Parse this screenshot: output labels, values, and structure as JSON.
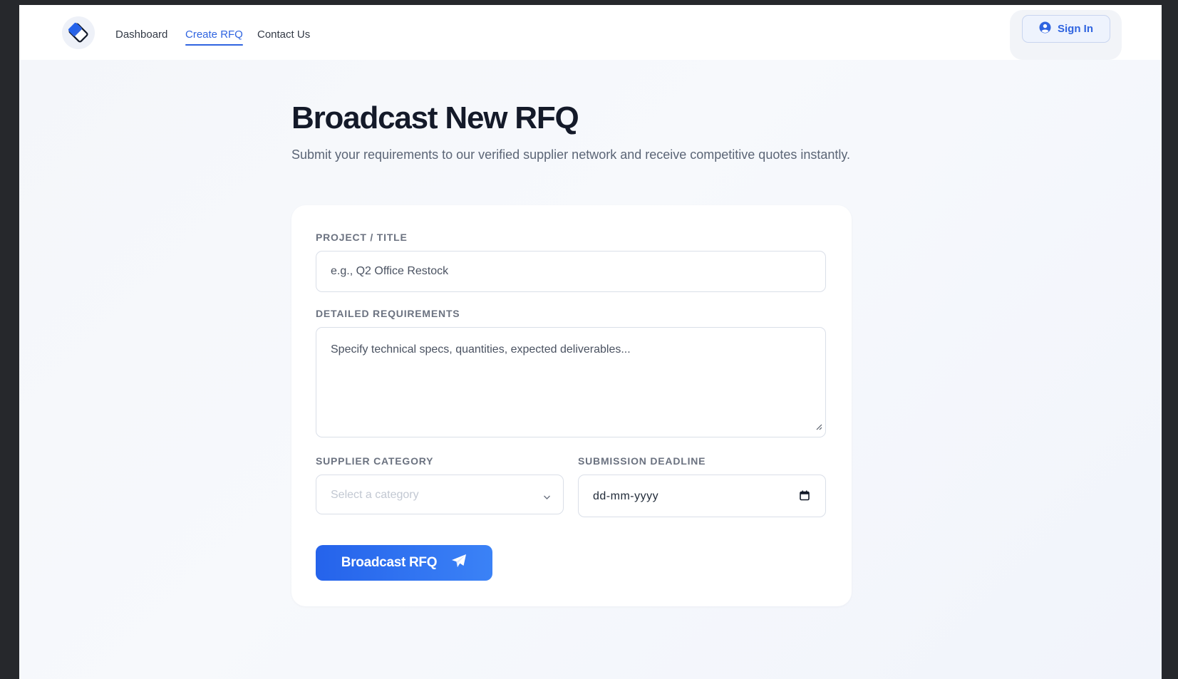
{
  "nav": {
    "logo_icon": "diamond-logo-icon",
    "links": [
      {
        "label": "Dashboard",
        "active": false
      },
      {
        "label": "Create RFQ",
        "active": true
      },
      {
        "label": "Contact Us",
        "active": false
      }
    ],
    "signin_label": "Sign In",
    "signin_icon": "user-circle-icon"
  },
  "page": {
    "title": "Broadcast New RFQ",
    "subtitle": "Submit your requirements to our verified supplier network and receive competitive quotes instantly."
  },
  "form": {
    "project_title": {
      "label": "PROJECT / TITLE",
      "placeholder": "e.g., Q2 Office Restock",
      "value": ""
    },
    "requirements": {
      "label": "DETAILED REQUIREMENTS",
      "placeholder": "Specify technical specs, quantities, expected deliverables...",
      "value": ""
    },
    "category": {
      "label": "SUPPLIER CATEGORY",
      "placeholder": "Select a category",
      "icon": "chevron-down-icon"
    },
    "deadline": {
      "label": "SUBMISSION DEADLINE",
      "placeholder": "dd-mm-yyyy",
      "icon": "calendar-icon"
    },
    "submit": {
      "label": "Broadcast RFQ",
      "icon": "paper-plane-icon"
    }
  },
  "colors": {
    "accent": "#2f64e0",
    "button_start": "#2563eb",
    "button_end": "#3b82f6",
    "title": "#141a29",
    "background": "#f4f6fa"
  }
}
